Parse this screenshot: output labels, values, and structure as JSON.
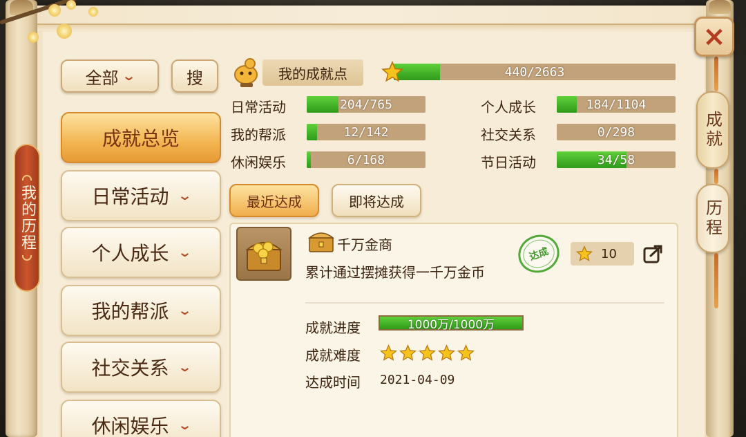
{
  "left_tab": {
    "label": "我的历程"
  },
  "right_tabs": [
    {
      "label": "成就"
    },
    {
      "label": "历程"
    }
  ],
  "close_label": "×",
  "filter": {
    "label": "全部"
  },
  "search": {
    "label": "搜"
  },
  "nav": [
    {
      "label": "成就总览",
      "active": true
    },
    {
      "label": "日常活动"
    },
    {
      "label": "个人成长"
    },
    {
      "label": "我的帮派"
    },
    {
      "label": "社交关系"
    },
    {
      "label": "休闲娱乐"
    }
  ],
  "points": {
    "label": "我的成就点",
    "value": "440/2663",
    "progress": 0.165
  },
  "categories": [
    {
      "label": "日常活动",
      "value": "204/765",
      "progress": 0.267
    },
    {
      "label": "个人成长",
      "value": "184/1104",
      "progress": 0.167
    },
    {
      "label": "我的帮派",
      "value": "12/142",
      "progress": 0.085
    },
    {
      "label": "社交关系",
      "value": "0/298",
      "progress": 0.0
    },
    {
      "label": "休闲娱乐",
      "value": "6/168",
      "progress": 0.036
    },
    {
      "label": "节日活动",
      "value": "34/58",
      "progress": 0.586
    }
  ],
  "tabs": [
    {
      "label": "最近达成",
      "active": true
    },
    {
      "label": "即将达成"
    }
  ],
  "achievement": {
    "title": "千万金商",
    "description": "累计通过摆摊获得一千万金币",
    "stamp": "达成",
    "reward": "10",
    "progress_label": "成就进度",
    "progress_value": "1000万/1000万",
    "difficulty_label": "成就难度",
    "difficulty_stars": 5,
    "time_label": "达成时间",
    "time_value": "2021-04-09"
  },
  "colors": {
    "bar_fill": "#3fae24",
    "bar_track": "#c2a27a",
    "active_nav": "#f3b552",
    "text_brown": "#3c2410",
    "left_tab": "#b8462a"
  }
}
